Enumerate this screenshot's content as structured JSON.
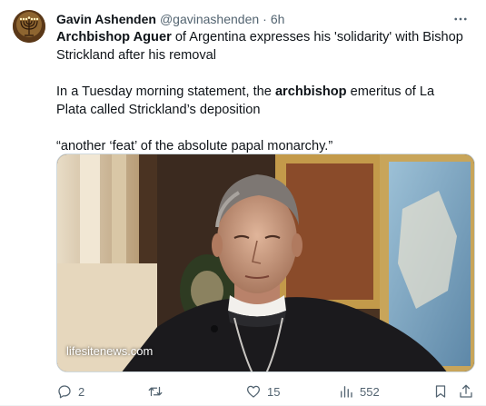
{
  "tweet": {
    "author_name": "Gavin Ashenden",
    "handle": "@gavinashenden",
    "separator": "·",
    "time": "6h",
    "text": {
      "line1_bold": "Archbishop Aguer",
      "line1_rest": " of Argentina expresses his 'solidarity' with Bishop Strickland after his removal",
      "para2_start": "In a Tuesday morning statement, the ",
      "para2_bold": "archbishop",
      "para2_end": " emeritus of La Plata called Strickland’s deposition",
      "para3": "“another ‘feat’ of the absolute papal monarchy.”"
    },
    "media": {
      "watermark": "lifesitenews.com"
    },
    "actions": {
      "reply_count": "2",
      "retweet_count": "",
      "like_count": "15",
      "views_count": "552"
    }
  },
  "colors": {
    "text": "#0f1419",
    "secondary": "#536471",
    "border": "#cfd9de"
  },
  "icons": [
    "more-icon",
    "reply-icon",
    "retweet-icon",
    "like-icon",
    "views-icon",
    "bookmark-icon",
    "share-icon"
  ]
}
